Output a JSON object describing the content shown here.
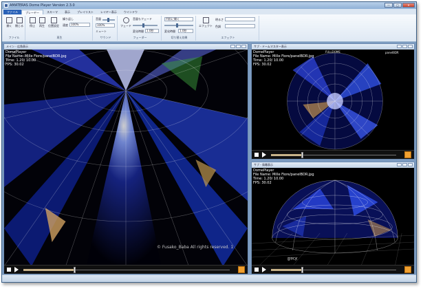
{
  "window": {
    "title": "AMATERAS Dome Player  Version 2.3.0",
    "min": "—",
    "max": "□",
    "close": "✕"
  },
  "tabs": [
    "ファイル",
    "プレーヤー",
    "スキーマ",
    "表示",
    "プレイリスト",
    "レイヤー表示",
    "ウインドウ"
  ],
  "ribbon": {
    "file_group": {
      "label": "ファイル",
      "open": "開く",
      "close": "閉じる"
    },
    "playback_group": {
      "label": "再生",
      "stop": "停止",
      "play": "再生",
      "position": "位置設定",
      "repeat": "繰り返し",
      "speed_label": "速度",
      "speed_value": "100%"
    },
    "sound_group": {
      "label": "サウンド",
      "volume_label": "音量",
      "volume_value": "100%",
      "mute": "ミュート"
    },
    "fade_group": {
      "label": "フェーダー",
      "fade_label": "フェード",
      "fade_option": "音量もフェード",
      "fade_time_label": "変化時間",
      "fade_time_value": "1.0秒"
    },
    "switch_group": {
      "label": "切り替え効果",
      "mode_value": "円形に開く",
      "time_label": "変化時間",
      "time_value": "1.0秒"
    },
    "effect_group": {
      "label": "エフェクト",
      "effect_button": "エフェクト",
      "brightness_label": "明るさ",
      "tint_label": "色調"
    }
  },
  "panels": {
    "main": {
      "title": "メイン - 広角表示",
      "overlay": [
        "DomePlayer",
        "File Name: Mille Fiore/panelBDR.jpg",
        "Time:    1.20/  10.00",
        "FPS: 30.02"
      ],
      "copyright": "© Fusako_Baba  All rights reserved. 1",
      "progress": 0.25
    },
    "master": {
      "title": "サブ - ドームマスター表示",
      "overlay": [
        "DomePlayer",
        "File Name: Mille Fiore/panelBDR.jpg",
        "Time:    1.20/  10.00",
        "FPS: 30.02"
      ],
      "logo_top": "FULLDOME",
      "logo_right": "panelBDR",
      "progress": 0.25
    },
    "bird": {
      "title": "サブ - 鳥瞰表示",
      "overlay": [
        "DomePlayer",
        "File Name: Mille Fiore/panelBDR.jpg",
        "Time:    1.20/  10.00",
        "FPS: 30.02"
      ],
      "back_label": "Back",
      "progress": 0.25
    }
  },
  "colors": {
    "accent": "#2a62b8",
    "frame": "#7d9cc1",
    "fullscreen": "#f0a030"
  }
}
